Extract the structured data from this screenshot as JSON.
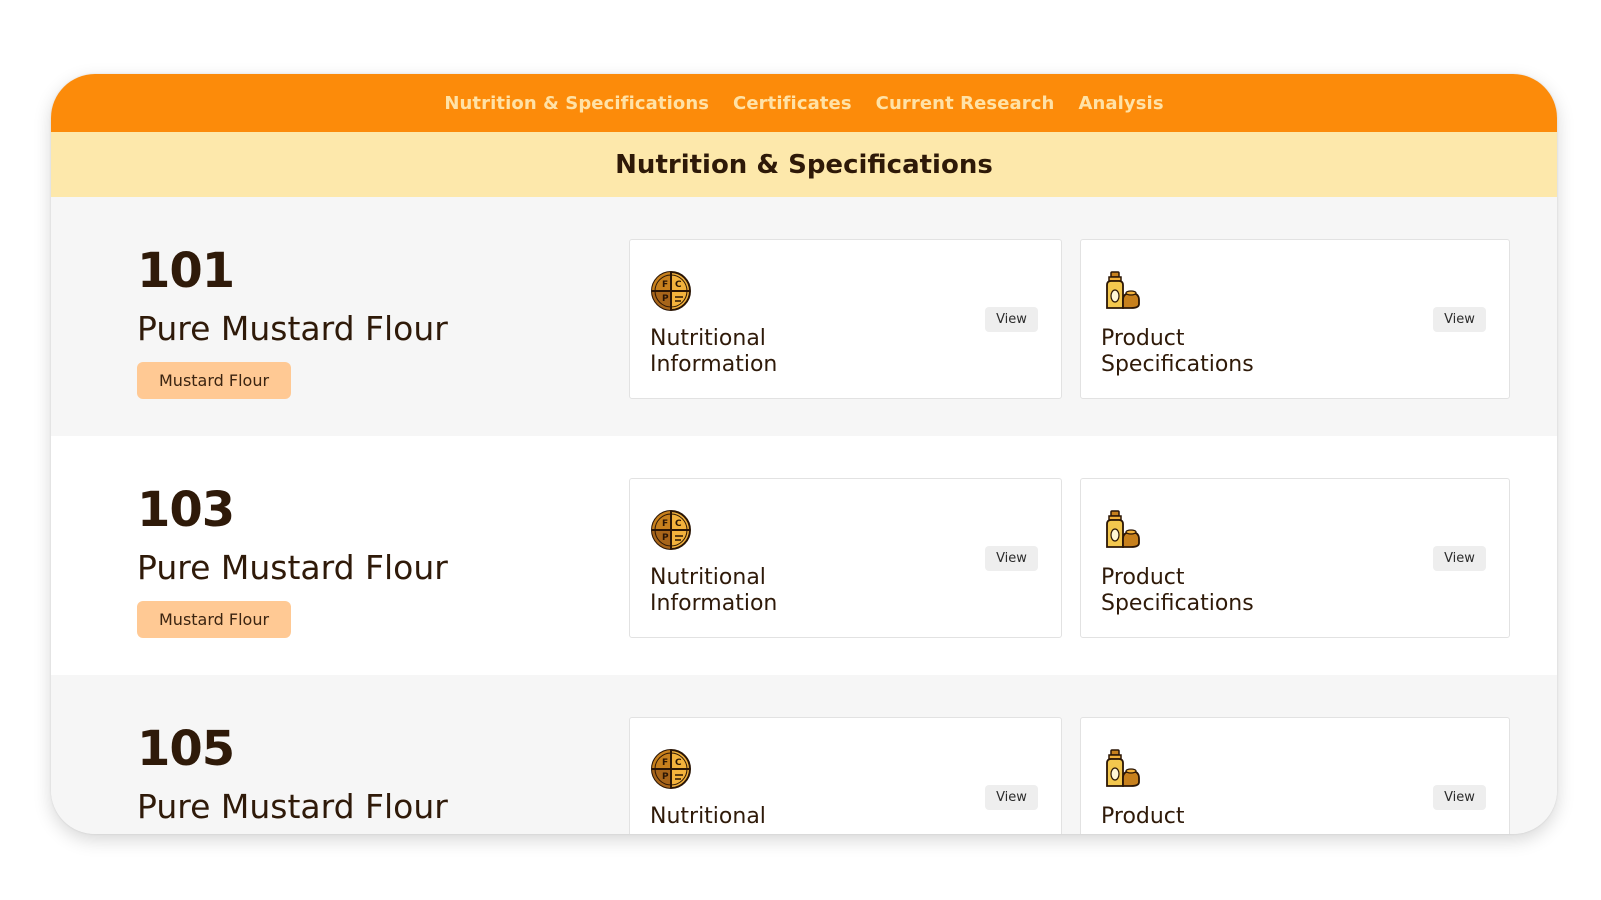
{
  "nav": {
    "items": [
      {
        "label": "Nutrition & Specifications"
      },
      {
        "label": "Certificates"
      },
      {
        "label": "Current Research"
      },
      {
        "label": "Analysis"
      }
    ]
  },
  "section": {
    "title": "Nutrition & Specifications"
  },
  "rows": [
    {
      "number": "101",
      "name": "Pure Mustard Flour",
      "tag": "Mustard Flour",
      "cards": [
        {
          "title": "Nutritional Information",
          "icon": "nutrition-chart-icon",
          "button": "View"
        },
        {
          "title": "Product Specifications",
          "icon": "product-bottles-icon",
          "button": "View"
        }
      ]
    },
    {
      "number": "103",
      "name": "Pure Mustard Flour",
      "tag": "Mustard Flour",
      "cards": [
        {
          "title": "Nutritional Information",
          "icon": "nutrition-chart-icon",
          "button": "View"
        },
        {
          "title": "Product Specifications",
          "icon": "product-bottles-icon",
          "button": "View"
        }
      ]
    },
    {
      "number": "105",
      "name": "Pure Mustard Flour",
      "cards": [
        {
          "title": "Nutritional",
          "icon": "nutrition-chart-icon",
          "button": "View"
        },
        {
          "title": "Product",
          "icon": "product-bottles-icon",
          "button": "View"
        }
      ]
    }
  ],
  "colors": {
    "nav_bg": "#fc8b0a",
    "nav_text": "#ffe2a6",
    "title_bar_bg": "#fde8ab",
    "tag_bg": "#ffc994",
    "text_dark": "#2f1a09"
  }
}
